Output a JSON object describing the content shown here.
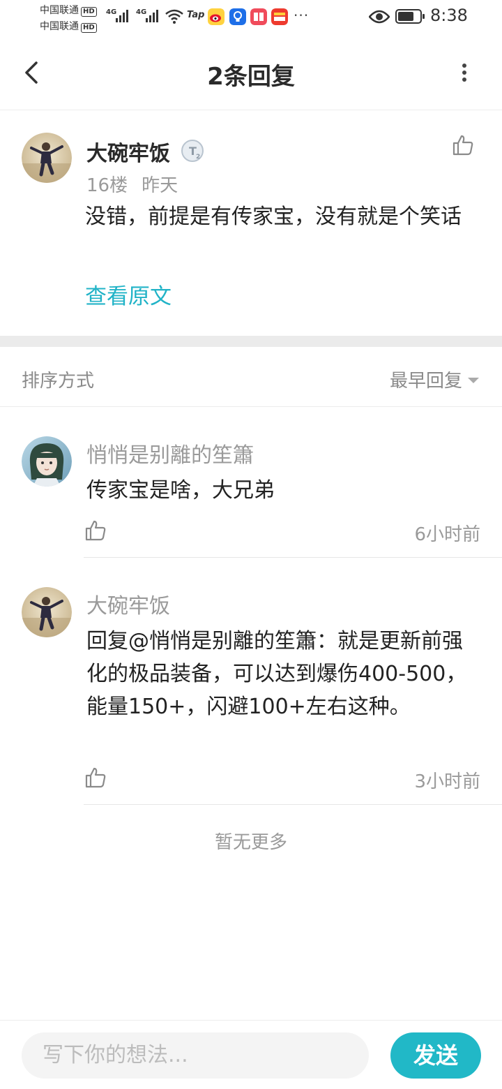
{
  "status_bar": {
    "carrier1": "中国联通",
    "carrier2": "中国联通",
    "hd_label": "HD",
    "network1": "4G",
    "network2": "4G",
    "tap_label": "Tap",
    "more_dots": "···",
    "time": "8:38",
    "icons": [
      "signal-icon",
      "wifi-icon",
      "taptap-icon",
      "weibo-icon",
      "bulb-app-icon",
      "book-app-icon",
      "wallet-app-icon",
      "eye-icon",
      "battery-icon"
    ]
  },
  "nav": {
    "title": "2条回复"
  },
  "post": {
    "author": "大碗牢饭",
    "floor": "16楼",
    "time": "昨天",
    "content": "没错，前提是有传家宝，没有就是个笑话",
    "view_original": "查看原文"
  },
  "sort": {
    "label": "排序方式",
    "value": "最早回复"
  },
  "replies": [
    {
      "author": "悄悄是别離的笙簫",
      "content": "传家宝是啥，大兄弟",
      "time": "6小时前"
    },
    {
      "author": "大碗牢饭",
      "reply_prefix": "回复",
      "mention": "@悄悄是别離的笙簫",
      "content": "：就是更新前强化的极品装备，可以达到爆伤400-500，能量150+，闪避100+左右这种。",
      "time": "3小时前"
    }
  ],
  "footer_note": "暂无更多",
  "composer": {
    "placeholder": "写下你的想法...",
    "send_label": "发送"
  },
  "colors": {
    "accent": "#21b8c7",
    "link": "#21b3c7",
    "muted_text": "#9a9a9a"
  }
}
